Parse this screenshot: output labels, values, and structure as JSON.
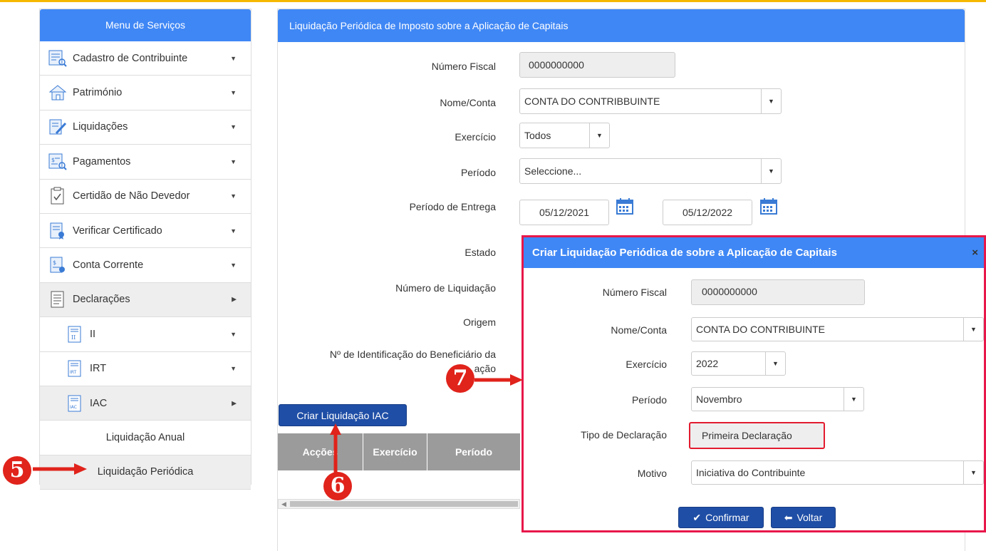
{
  "colors": {
    "accent": "#3f87f5",
    "button": "#1f4ea6",
    "highlight": "#e8174a",
    "badge": "#e0231b"
  },
  "sidebar": {
    "title": "Menu de Serviços",
    "items": [
      {
        "label": "Cadastro de Contribuinte",
        "icon": "form-search-icon",
        "caret": "▼"
      },
      {
        "label": "Património",
        "icon": "house-icon",
        "caret": "▼"
      },
      {
        "label": "Liquidações",
        "icon": "pencil-document-icon",
        "caret": "▼"
      },
      {
        "label": "Pagamentos",
        "icon": "payment-search-icon",
        "caret": "▼"
      },
      {
        "label": "Certidão de Não Devedor",
        "icon": "checklist-icon",
        "caret": "▼"
      },
      {
        "label": "Verificar Certificado",
        "icon": "certificate-icon",
        "caret": "▼"
      },
      {
        "label": "Conta Corrente",
        "icon": "account-icon",
        "caret": "▼"
      },
      {
        "label": "Declarações",
        "icon": "declaration-icon",
        "caret": "▶"
      },
      {
        "label": "II",
        "icon": "ii-document-icon",
        "caret": "▼"
      },
      {
        "label": "IRT",
        "icon": "irt-document-icon",
        "caret": "▼"
      },
      {
        "label": "IAC",
        "icon": "iac-document-icon",
        "caret": "▶"
      },
      {
        "label": "Liquidação Anual"
      },
      {
        "label": "Liquidação Periódica"
      }
    ]
  },
  "main": {
    "title": "Liquidação Periódica de Imposto sobre a Aplicação de Capitais",
    "fields": {
      "numero_fiscal": {
        "label": "Número Fiscal",
        "value": "0000000000"
      },
      "nome_conta": {
        "label": "Nome/Conta",
        "value": "CONTA DO CONTRIBBUINTE"
      },
      "exercicio": {
        "label": "Exercício",
        "value": "Todos"
      },
      "periodo": {
        "label": "Período",
        "value": "Seleccione..."
      },
      "periodo_entrega": {
        "label": "Período de Entrega",
        "from": "05/12/2021",
        "to": "05/12/2022"
      },
      "estado": {
        "label": "Estado"
      },
      "numero_liquidacao": {
        "label": "Número de Liquidação"
      },
      "origem": {
        "label": "Origem"
      },
      "nid_beneficiario": {
        "label_line1": "Nº de Identificação do Beneficiário da",
        "label_line2": "ação"
      }
    },
    "create_button": "Criar Liquidação IAC",
    "table_headers": [
      "Acções",
      "Exercício",
      "Período"
    ]
  },
  "modal": {
    "title": "Criar Liquidação Periódica de sobre a Aplicação de Capitais",
    "close": "×",
    "fields": {
      "numero_fiscal": {
        "label": "Número Fiscal",
        "value": "0000000000"
      },
      "nome_conta": {
        "label": "Nome/Conta",
        "value": "CONTA DO CONTRIBUINTE"
      },
      "exercicio": {
        "label": "Exercício",
        "value": "2022"
      },
      "periodo": {
        "label": "Período",
        "value": "Novembro"
      },
      "tipo_declaracao": {
        "label": "Tipo de Declaração",
        "value": "Primeira Declaração"
      },
      "motivo": {
        "label": "Motivo",
        "value": "Iniciativa do Contribuinte"
      }
    },
    "confirm_button": "Confirmar",
    "back_button": "Voltar"
  },
  "annotations": {
    "step5": "5",
    "step6": "6",
    "step7": "7"
  }
}
